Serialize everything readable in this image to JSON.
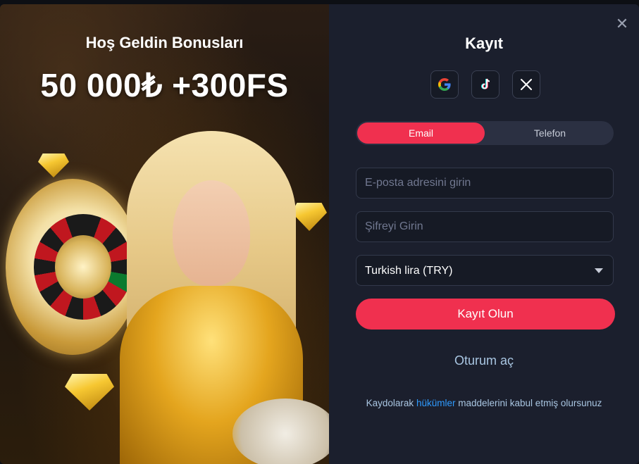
{
  "promo": {
    "title": "Hoş Geldin Bonusları",
    "amount": "50 000₺ +300FS"
  },
  "form": {
    "title": "Kayıt",
    "close_icon": "close-icon",
    "socials": [
      {
        "name": "google",
        "icon": "google-icon"
      },
      {
        "name": "tiktok",
        "icon": "tiktok-icon"
      },
      {
        "name": "x",
        "icon": "x-icon"
      }
    ],
    "tabs": [
      {
        "label": "Email",
        "active": true
      },
      {
        "label": "Telefon",
        "active": false
      }
    ],
    "email_placeholder": "E-posta adresini girin",
    "password_placeholder": "Şifreyi Girin",
    "currency_selected": "Turkish lira (TRY)",
    "submit_label": "Kayıt Olun",
    "login_label": "Oturum aç",
    "terms_prefix": "Kaydolarak",
    "terms_link": "hükümler",
    "terms_suffix": "maddelerini kabul etmiş olursunuz"
  },
  "colors": {
    "accent": "#f0304f",
    "panel_bg": "#1b1f2d",
    "link": "#2f9bff",
    "muted_text": "#a9c6e2"
  }
}
